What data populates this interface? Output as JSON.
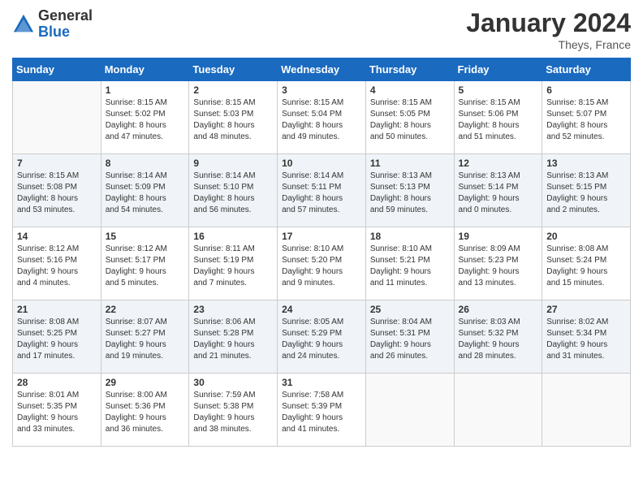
{
  "logo": {
    "general": "General",
    "blue": "Blue"
  },
  "header": {
    "month": "January 2024",
    "location": "Theys, France"
  },
  "days_of_week": [
    "Sunday",
    "Monday",
    "Tuesday",
    "Wednesday",
    "Thursday",
    "Friday",
    "Saturday"
  ],
  "weeks": [
    [
      {
        "day": "",
        "info": ""
      },
      {
        "day": "1",
        "info": "Sunrise: 8:15 AM\nSunset: 5:02 PM\nDaylight: 8 hours\nand 47 minutes."
      },
      {
        "day": "2",
        "info": "Sunrise: 8:15 AM\nSunset: 5:03 PM\nDaylight: 8 hours\nand 48 minutes."
      },
      {
        "day": "3",
        "info": "Sunrise: 8:15 AM\nSunset: 5:04 PM\nDaylight: 8 hours\nand 49 minutes."
      },
      {
        "day": "4",
        "info": "Sunrise: 8:15 AM\nSunset: 5:05 PM\nDaylight: 8 hours\nand 50 minutes."
      },
      {
        "day": "5",
        "info": "Sunrise: 8:15 AM\nSunset: 5:06 PM\nDaylight: 8 hours\nand 51 minutes."
      },
      {
        "day": "6",
        "info": "Sunrise: 8:15 AM\nSunset: 5:07 PM\nDaylight: 8 hours\nand 52 minutes."
      }
    ],
    [
      {
        "day": "7",
        "info": "Sunrise: 8:15 AM\nSunset: 5:08 PM\nDaylight: 8 hours\nand 53 minutes."
      },
      {
        "day": "8",
        "info": "Sunrise: 8:14 AM\nSunset: 5:09 PM\nDaylight: 8 hours\nand 54 minutes."
      },
      {
        "day": "9",
        "info": "Sunrise: 8:14 AM\nSunset: 5:10 PM\nDaylight: 8 hours\nand 56 minutes."
      },
      {
        "day": "10",
        "info": "Sunrise: 8:14 AM\nSunset: 5:11 PM\nDaylight: 8 hours\nand 57 minutes."
      },
      {
        "day": "11",
        "info": "Sunrise: 8:13 AM\nSunset: 5:13 PM\nDaylight: 8 hours\nand 59 minutes."
      },
      {
        "day": "12",
        "info": "Sunrise: 8:13 AM\nSunset: 5:14 PM\nDaylight: 9 hours\nand 0 minutes."
      },
      {
        "day": "13",
        "info": "Sunrise: 8:13 AM\nSunset: 5:15 PM\nDaylight: 9 hours\nand 2 minutes."
      }
    ],
    [
      {
        "day": "14",
        "info": "Sunrise: 8:12 AM\nSunset: 5:16 PM\nDaylight: 9 hours\nand 4 minutes."
      },
      {
        "day": "15",
        "info": "Sunrise: 8:12 AM\nSunset: 5:17 PM\nDaylight: 9 hours\nand 5 minutes."
      },
      {
        "day": "16",
        "info": "Sunrise: 8:11 AM\nSunset: 5:19 PM\nDaylight: 9 hours\nand 7 minutes."
      },
      {
        "day": "17",
        "info": "Sunrise: 8:10 AM\nSunset: 5:20 PM\nDaylight: 9 hours\nand 9 minutes."
      },
      {
        "day": "18",
        "info": "Sunrise: 8:10 AM\nSunset: 5:21 PM\nDaylight: 9 hours\nand 11 minutes."
      },
      {
        "day": "19",
        "info": "Sunrise: 8:09 AM\nSunset: 5:23 PM\nDaylight: 9 hours\nand 13 minutes."
      },
      {
        "day": "20",
        "info": "Sunrise: 8:08 AM\nSunset: 5:24 PM\nDaylight: 9 hours\nand 15 minutes."
      }
    ],
    [
      {
        "day": "21",
        "info": "Sunrise: 8:08 AM\nSunset: 5:25 PM\nDaylight: 9 hours\nand 17 minutes."
      },
      {
        "day": "22",
        "info": "Sunrise: 8:07 AM\nSunset: 5:27 PM\nDaylight: 9 hours\nand 19 minutes."
      },
      {
        "day": "23",
        "info": "Sunrise: 8:06 AM\nSunset: 5:28 PM\nDaylight: 9 hours\nand 21 minutes."
      },
      {
        "day": "24",
        "info": "Sunrise: 8:05 AM\nSunset: 5:29 PM\nDaylight: 9 hours\nand 24 minutes."
      },
      {
        "day": "25",
        "info": "Sunrise: 8:04 AM\nSunset: 5:31 PM\nDaylight: 9 hours\nand 26 minutes."
      },
      {
        "day": "26",
        "info": "Sunrise: 8:03 AM\nSunset: 5:32 PM\nDaylight: 9 hours\nand 28 minutes."
      },
      {
        "day": "27",
        "info": "Sunrise: 8:02 AM\nSunset: 5:34 PM\nDaylight: 9 hours\nand 31 minutes."
      }
    ],
    [
      {
        "day": "28",
        "info": "Sunrise: 8:01 AM\nSunset: 5:35 PM\nDaylight: 9 hours\nand 33 minutes."
      },
      {
        "day": "29",
        "info": "Sunrise: 8:00 AM\nSunset: 5:36 PM\nDaylight: 9 hours\nand 36 minutes."
      },
      {
        "day": "30",
        "info": "Sunrise: 7:59 AM\nSunset: 5:38 PM\nDaylight: 9 hours\nand 38 minutes."
      },
      {
        "day": "31",
        "info": "Sunrise: 7:58 AM\nSunset: 5:39 PM\nDaylight: 9 hours\nand 41 minutes."
      },
      {
        "day": "",
        "info": ""
      },
      {
        "day": "",
        "info": ""
      },
      {
        "day": "",
        "info": ""
      }
    ]
  ]
}
